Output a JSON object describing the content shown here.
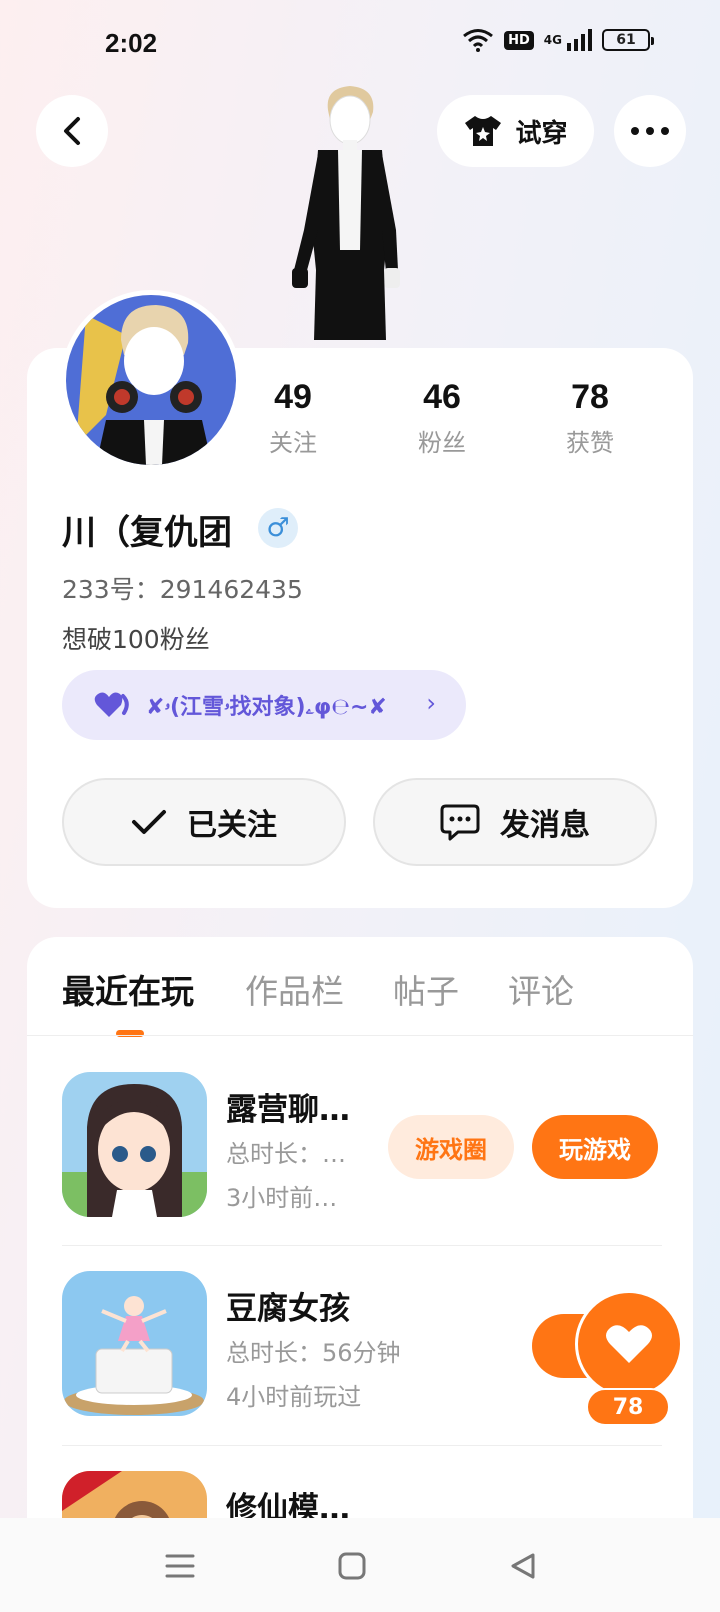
{
  "status_bar": {
    "time": "2:02",
    "network_badge": "HD",
    "network_type": "4G",
    "battery": "61"
  },
  "header": {
    "try_on_label": "试穿"
  },
  "profile": {
    "stats": [
      {
        "value": "49",
        "label": "关注"
      },
      {
        "value": "46",
        "label": "粉丝"
      },
      {
        "value": "78",
        "label": "获赞"
      }
    ],
    "name": "川（复仇团",
    "gender_symbol": "♂",
    "id_text": "233号：291462435",
    "bio": "想破100粉丝",
    "group_tag": "✘ۥ(江雪ۥ找对象)ۦφ℮~✘",
    "follow_label": "已关注",
    "message_label": "发消息"
  },
  "tabs": [
    {
      "label": "最近在玩"
    },
    {
      "label": "作品栏"
    },
    {
      "label": "帖子"
    },
    {
      "label": "评论"
    }
  ],
  "games": [
    {
      "title": "露营聊…",
      "duration": "总时长：…",
      "played": "3小时前…",
      "circle_label": "游戏圈",
      "play_label": "玩游戏"
    },
    {
      "title": "豆腐女孩",
      "duration": "总时长：56分钟",
      "played": "4小时前玩过",
      "play_label": "玩"
    },
    {
      "title": "修仙模…"
    }
  ],
  "like_fab": {
    "count": "78"
  },
  "colors": {
    "accent": "#ff7514",
    "tag_purple": "#6357d9",
    "gender_blue": "#3b8fd9"
  },
  "icons": [
    "back-arrow-icon",
    "tshirt-icon",
    "more-dots-icon",
    "heart-icon",
    "check-icon",
    "chat-bubble-icon",
    "chevron-right-icon",
    "menu-icon",
    "home-square-icon",
    "back-triangle-icon"
  ]
}
